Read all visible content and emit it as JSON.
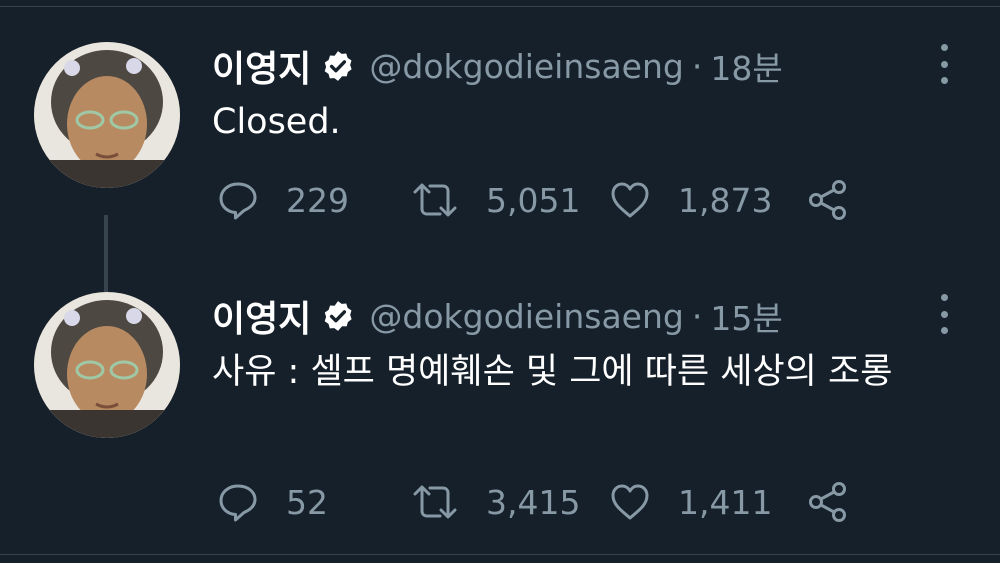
{
  "colors": {
    "background": "#15202b",
    "divider": "#38444d",
    "text_primary": "#ffffff",
    "text_secondary": "#8899a6"
  },
  "icons": {
    "verified": "verified-badge-icon",
    "more": "more-vertical-icon",
    "reply": "reply-icon",
    "retweet": "retweet-icon",
    "like": "heart-icon",
    "share": "share-icon"
  },
  "tweets": [
    {
      "name": "이영지",
      "handle": "@dokgodieinsaeng",
      "separator": "·",
      "time": "18분",
      "text": "Closed.",
      "replies": "229",
      "retweets": "5,051",
      "likes": "1,873"
    },
    {
      "name": "이영지",
      "handle": "@dokgodieinsaeng",
      "separator": "·",
      "time": "15분",
      "text": "사유 : 셀프 명예훼손 및 그에 따른 세상의 조롱",
      "replies": "52",
      "retweets": "3,415",
      "likes": "1,411"
    }
  ]
}
